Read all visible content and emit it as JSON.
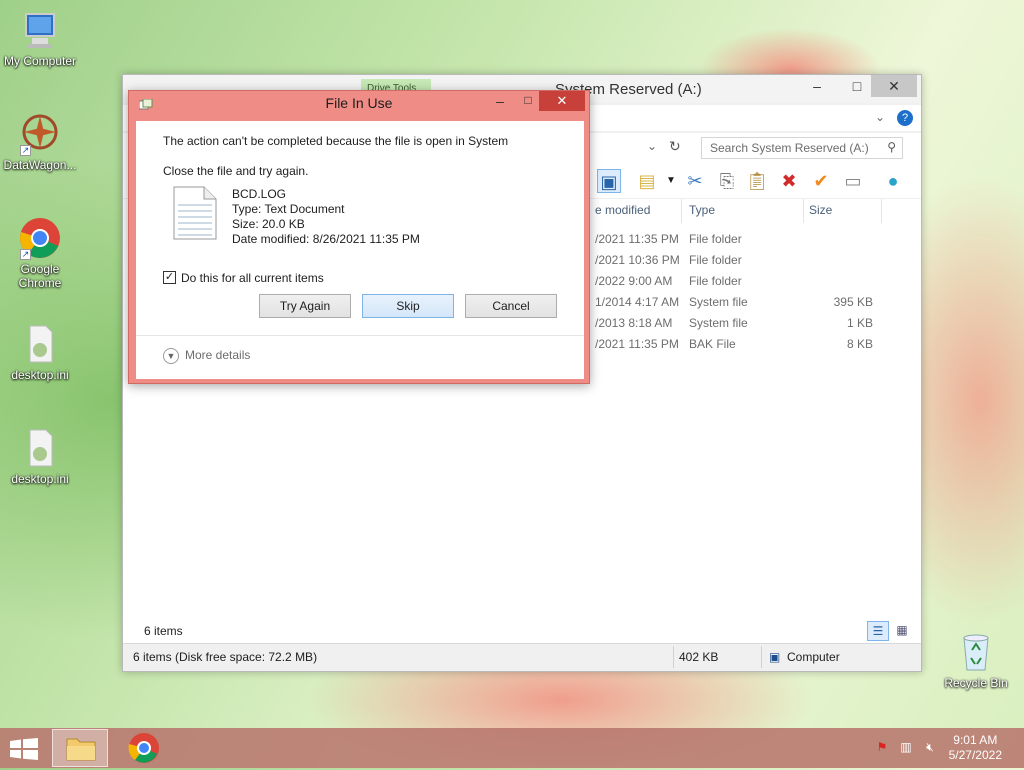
{
  "desktop": {
    "icons": [
      {
        "label": "My Computer",
        "icon": "computer-icon"
      },
      {
        "label": "DataWagon...",
        "icon": "datawagon-icon"
      },
      {
        "label": "Google Chrome",
        "icon": "chrome-icon"
      },
      {
        "label": "desktop.ini",
        "icon": "ini-file-icon"
      },
      {
        "label": "desktop.ini",
        "icon": "ini-file-icon"
      },
      {
        "label": "Recycle Bin",
        "icon": "recycle-bin-icon"
      }
    ]
  },
  "explorer": {
    "title": "System Reserved (A:)",
    "ribbon_tab": "Drive Tools",
    "search_placeholder": "Search System Reserved (A:)",
    "columns": [
      "Date modified",
      "Type",
      "Size"
    ],
    "column_heads_visible": [
      "e modified",
      "Type",
      "Size"
    ],
    "rows": [
      {
        "date": "/2021 11:35 PM",
        "type": "File folder",
        "size": ""
      },
      {
        "date": "/2021 10:36 PM",
        "type": "File folder",
        "size": ""
      },
      {
        "date": "/2022 9:00 AM",
        "type": "File folder",
        "size": ""
      },
      {
        "date": "1/2014 4:17 AM",
        "type": "System file",
        "size": "395 KB"
      },
      {
        "date": "/2013 8:18 AM",
        "type": "System file",
        "size": "1 KB"
      },
      {
        "date": "/2021 11:35 PM",
        "type": "BAK File",
        "size": "8 KB"
      }
    ],
    "item_count": "6 items",
    "status_left": "6 items (Disk free space: 72.2 MB)",
    "status_size": "402 KB",
    "status_location": "Computer"
  },
  "dialog": {
    "title": "File In Use",
    "message": "The action can't be completed because the file is open in System",
    "instruction": "Close the file and try again.",
    "file": {
      "name": "BCD.LOG",
      "type": "Type: Text Document",
      "size": "Size: 20.0 KB",
      "modified": "Date modified: 8/26/2021 11:35 PM"
    },
    "checkbox_label": "Do this for all current items",
    "checkbox_checked": true,
    "buttons": {
      "try_again": "Try Again",
      "skip": "Skip",
      "cancel": "Cancel"
    },
    "more_details": "More details"
  },
  "taskbar": {
    "time": "9:01 AM",
    "date": "5/27/2022"
  },
  "colors": {
    "dialog_frame": "#f08c86",
    "close_button": "#c7403a",
    "taskbar": "#b7766d"
  }
}
